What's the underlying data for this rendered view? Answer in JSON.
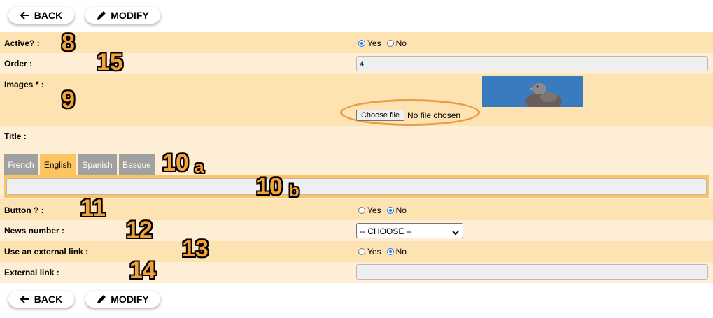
{
  "toolbar": {
    "back_label": "BACK",
    "modify_label": "MODIFY"
  },
  "fields": {
    "active": {
      "label": "Active? :",
      "yes": "Yes",
      "no": "No",
      "selected": "Yes"
    },
    "order": {
      "label": "Order :",
      "value": "4"
    },
    "images": {
      "label": "Images * :",
      "choose_file": "Choose file",
      "no_file": "No file chosen"
    },
    "title": {
      "label": "Title :",
      "tabs": [
        "French",
        "English",
        "Spanish",
        "Basque"
      ],
      "active_tab": "English",
      "value": ""
    },
    "button": {
      "label": "Button ? :",
      "yes": "Yes",
      "no": "No",
      "selected": "No"
    },
    "news_number": {
      "label": "News number :",
      "selected": "-- CHOOSE --"
    },
    "external": {
      "label": "Use an external link :",
      "yes": "Yes",
      "no": "No",
      "selected": "No"
    },
    "external_link": {
      "label": "External link :",
      "value": ""
    }
  },
  "annotations": {
    "a8": "8",
    "a15": "15",
    "a9": "9",
    "a10a_num": "10",
    "a10a_suf": "a",
    "a10b_num": "10",
    "a10b_suf": "b",
    "a11": "11",
    "a12": "12",
    "a13": "13",
    "a14": "14"
  },
  "colors": {
    "row_dark": "#fde2b2",
    "row_light": "#fdeed5",
    "tab_active": "#fcc562",
    "tab_inactive": "#a0a0a0",
    "annotation": "#f5a13a",
    "highlight_ring": "#e99b45"
  },
  "icons": {
    "back": "arrow-left-icon",
    "modify": "pencil-icon"
  }
}
